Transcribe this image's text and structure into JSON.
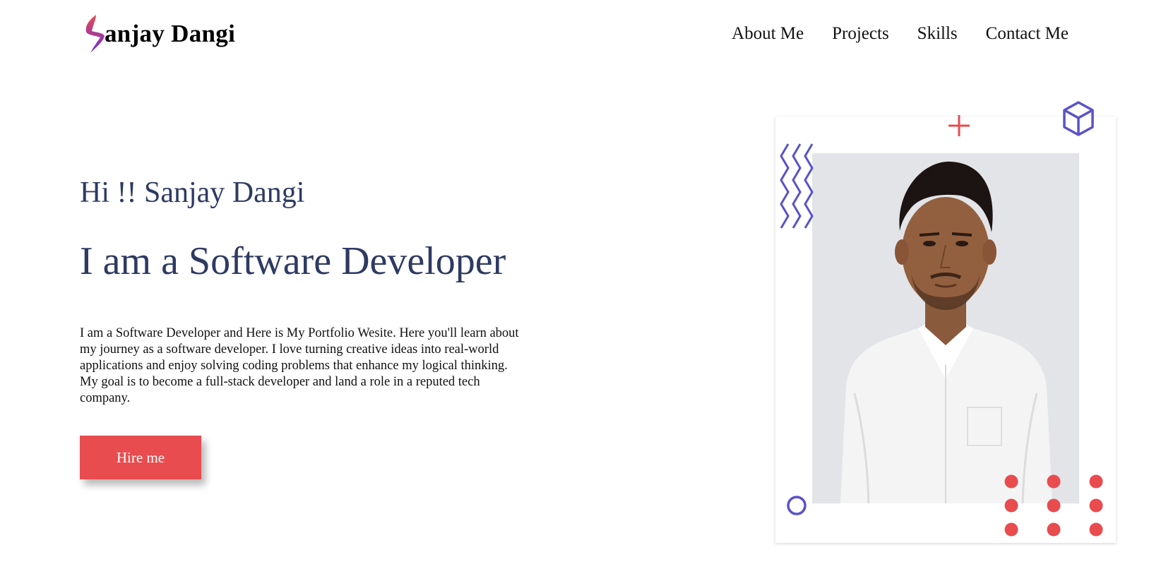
{
  "brand": {
    "name": "anjay Dangi",
    "logo_letter": "S",
    "logo_colors": [
      "#e84c4f",
      "#6c2bd9"
    ]
  },
  "nav": {
    "items": [
      {
        "label": "About Me"
      },
      {
        "label": "Projects"
      },
      {
        "label": "Skills"
      },
      {
        "label": "Contact Me"
      }
    ]
  },
  "hero": {
    "greeting": "Hi !! Sanjay Dangi",
    "headline": "I am a Software Developer",
    "intro": "I am a Software Developer and Here is My Portfolio Wesite. Here you'll learn about my journey as a software developer. I love turning creative ideas into real-world applications and enjoy solving coding problems that enhance my logical thinking. My goal is to become a full-stack developer and land a role in a reputed tech company.",
    "cta_label": "Hire me"
  },
  "colors": {
    "heading": "#2e3a62",
    "accent_red": "#e84c4f",
    "accent_blue": "#5a52c8"
  },
  "icons": {
    "plus": "plus-icon",
    "cube": "cube-icon",
    "zigzag": "zigzag-icon",
    "circle": "circle-icon",
    "dots": "dot-grid-icon"
  }
}
